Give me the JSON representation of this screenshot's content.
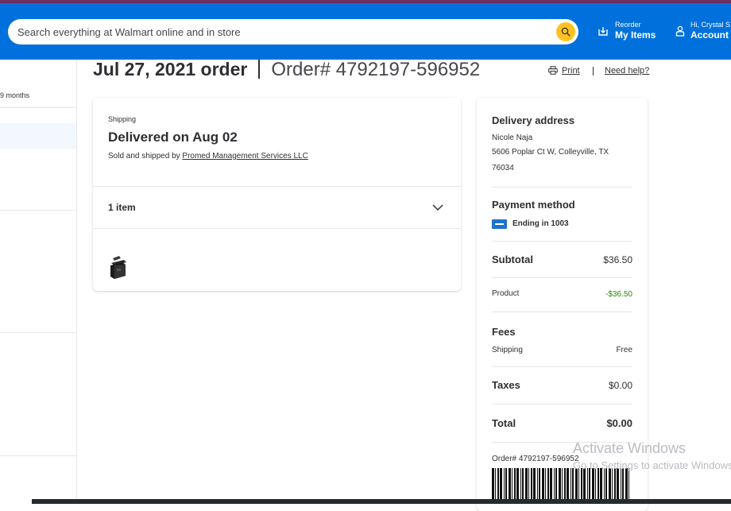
{
  "header": {
    "search_placeholder": "Search everything at Walmart online and in store",
    "reorder_small": "Reorder",
    "reorder_big": "My Items",
    "account_small": "Hi, Crystal S",
    "account_big": "Account"
  },
  "sidebar": {
    "months_label": "9 months"
  },
  "order": {
    "date_title": "Jul 27, 2021 order",
    "number_title": "Order# 4792197-596952",
    "print_label": "Print",
    "help_label": "Need help?"
  },
  "shipment": {
    "section_label": "Shipping",
    "status": "Delivered on Aug 02",
    "sold_by_prefix": "Sold and shipped by",
    "seller": "Promed Management Services LLC",
    "items_count": "1 item"
  },
  "summary": {
    "address_heading": "Delivery address",
    "address_name": "Nicole Naja",
    "address_line1": "5606 Poplar Ct W, Colleyville, TX",
    "address_line2": "76034",
    "payment_heading": "Payment method",
    "card_text": "Ending in 1003",
    "subtotal_label": "Subtotal",
    "subtotal_value": "$36.50",
    "product_label": "Product",
    "product_value": "-$36.50",
    "fees_heading": "Fees",
    "shipping_label": "Shipping",
    "shipping_value": "Free",
    "taxes_label": "Taxes",
    "taxes_value": "$0.00",
    "total_label": "Total",
    "total_value": "$0.00",
    "order_number": "Order# 4792197-596952"
  },
  "watermark": {
    "line1": "Activate Windows",
    "line2": "Go to Settings to activate Windows."
  },
  "colors": {
    "header_blue": "#0071dc",
    "search_button_yellow": "#ffc220",
    "discount_green": "#2a8703",
    "card_brand_blue": "#1f72cd"
  },
  "icons": [
    "search-icon",
    "reorder-icon",
    "account-icon",
    "printer-icon",
    "chevron-down-icon",
    "credit-card-icon"
  ]
}
